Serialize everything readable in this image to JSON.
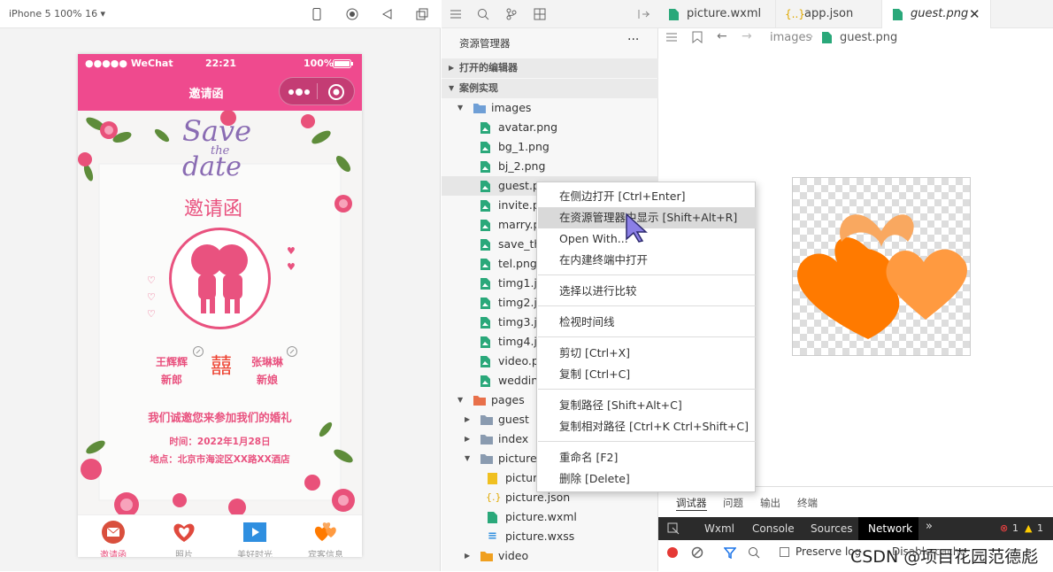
{
  "simulator": {
    "device_label": "iPhone 5 100% 16 ▾",
    "status": {
      "signal": "●●●●● WeChat",
      "time": "22:21",
      "battery": "100%"
    },
    "nav_title": "邀请函",
    "card": {
      "save_line1": "Save",
      "save_the": "the",
      "save_line2": "date",
      "title": "邀请函",
      "groom_name": "王辉辉",
      "groom_role": "新郎",
      "bride_name": "张琳琳",
      "bride_role": "新娘",
      "double_happiness": "囍",
      "invite": "我们诚邀您来参加我们的婚礼",
      "time": "时间：2022年1月28日",
      "place": "地点：北京市海淀区XX路XX酒店"
    },
    "tabs": [
      {
        "label": "邀请函"
      },
      {
        "label": "照片"
      },
      {
        "label": "美好时光"
      },
      {
        "label": "宾客信息"
      }
    ]
  },
  "explorer": {
    "header": "资源管理器",
    "more": "···",
    "open_editors": "打开的编辑器",
    "project": "案例实现",
    "images_folder": "images",
    "files": [
      "avatar.png",
      "bg_1.png",
      "bj_2.png",
      "guest.p",
      "invite.p",
      "marry.p",
      "save_th",
      "tel.png",
      "timg1.jp",
      "timg2.jp",
      "timg3.jp",
      "timg4.jp",
      "video.p",
      "weddin"
    ],
    "pages_folder": "pages",
    "page_folders": [
      "guest",
      "index",
      "picture"
    ],
    "picture_files": [
      "picture",
      "picture.json",
      "picture.wxml",
      "picture.wxss"
    ],
    "video_folder": "video"
  },
  "editor": {
    "tabs": [
      {
        "label": "picture.wxml"
      },
      {
        "label": "app.json"
      },
      {
        "label": "guest.png"
      }
    ],
    "breadcrumb": {
      "folder": "images",
      "file": "guest.png"
    }
  },
  "panel": {
    "tabs": [
      "调试器",
      "问题",
      "输出",
      "终端"
    ],
    "devtools": [
      "Wxml",
      "Console",
      "Sources",
      "Network"
    ],
    "errors": "1",
    "warnings": "1",
    "preserve_log": "Preserve log",
    "disable_cache": "Disable cache"
  },
  "context_menu": [
    {
      "label": "在侧边打开  [Ctrl+Enter]"
    },
    {
      "label": "在资源管理器中显示  [Shift+Alt+R]"
    },
    {
      "label": "Open With..."
    },
    {
      "label": "在内建终端中打开"
    },
    {
      "label": "选择以进行比较"
    },
    {
      "label": "检视时间线"
    },
    {
      "label": "剪切  [Ctrl+X]"
    },
    {
      "label": "复制  [Ctrl+C]"
    },
    {
      "label": "复制路径  [Shift+Alt+C]"
    },
    {
      "label": "复制相对路径  [Ctrl+K Ctrl+Shift+C]"
    },
    {
      "label": "重命名  [F2]"
    },
    {
      "label": "删除  [Delete]"
    }
  ],
  "watermark": "CSDN @项目花园范德彪",
  "colors": {
    "pink": "#ef4a8e",
    "orange": "#ff7a00",
    "light_orange": "#f9a860"
  }
}
